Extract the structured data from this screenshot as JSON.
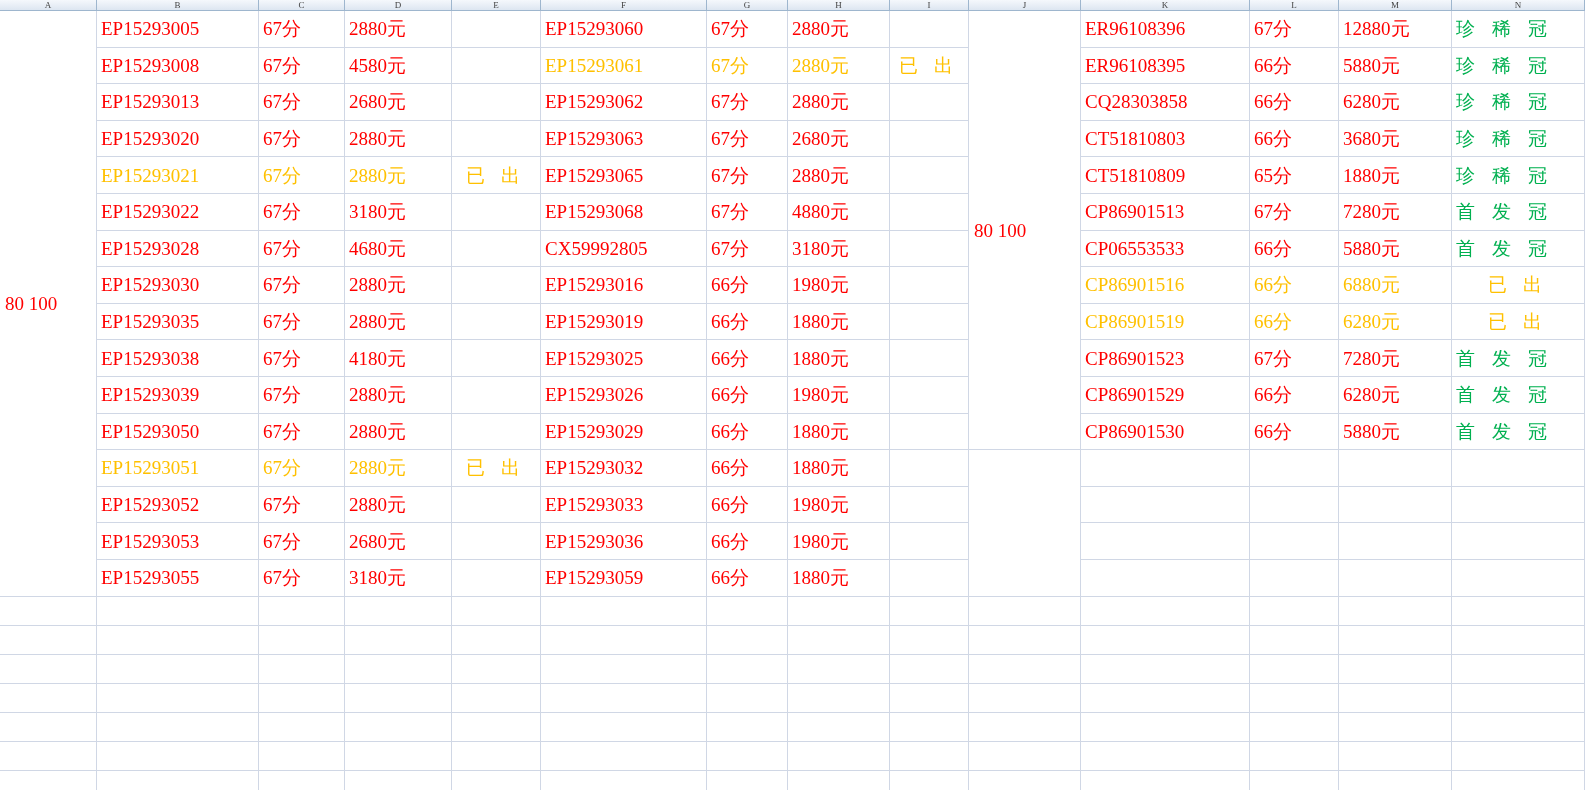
{
  "column_headers": [
    "A",
    "B",
    "C",
    "D",
    "E",
    "F",
    "G",
    "H",
    "I",
    "J",
    "K",
    "L",
    "M",
    "N"
  ],
  "left_group": {
    "label": "80 100",
    "rows": [
      [
        {
          "code": "EP15293005",
          "score": "67分",
          "price": "2880元",
          "sold": false
        },
        {
          "code": "EP15293060",
          "score": "67分",
          "price": "2880元",
          "sold": false
        }
      ],
      [
        {
          "code": "EP15293008",
          "score": "67分",
          "price": "4580元",
          "sold": false
        },
        {
          "code": "EP15293061",
          "score": "67分",
          "price": "2880元",
          "sold": true,
          "note": "已 出"
        }
      ],
      [
        {
          "code": "EP15293013",
          "score": "67分",
          "price": "2680元",
          "sold": false
        },
        {
          "code": "EP15293062",
          "score": "67分",
          "price": "2880元",
          "sold": false
        }
      ],
      [
        {
          "code": "EP15293020",
          "score": "67分",
          "price": "2880元",
          "sold": false
        },
        {
          "code": "EP15293063",
          "score": "67分",
          "price": "2680元",
          "sold": false
        }
      ],
      [
        {
          "code": "EP15293021",
          "score": "67分",
          "price": "2880元",
          "sold": true,
          "note": "已 出"
        },
        {
          "code": "EP15293065",
          "score": "67分",
          "price": "2880元",
          "sold": false
        }
      ],
      [
        {
          "code": "EP15293022",
          "score": "67分",
          "price": "3180元",
          "sold": false
        },
        {
          "code": "EP15293068",
          "score": "67分",
          "price": "4880元",
          "sold": false
        }
      ],
      [
        {
          "code": "EP15293028",
          "score": "67分",
          "price": "4680元",
          "sold": false
        },
        {
          "code": "CX59992805",
          "score": "67分",
          "price": "3180元",
          "sold": false
        }
      ],
      [
        {
          "code": "EP15293030",
          "score": "67分",
          "price": "2880元",
          "sold": false
        },
        {
          "code": "EP15293016",
          "score": "66分",
          "price": "1980元",
          "sold": false
        }
      ],
      [
        {
          "code": "EP15293035",
          "score": "67分",
          "price": "2880元",
          "sold": false
        },
        {
          "code": "EP15293019",
          "score": "66分",
          "price": "1880元",
          "sold": false
        }
      ],
      [
        {
          "code": "EP15293038",
          "score": "67分",
          "price": "4180元",
          "sold": false
        },
        {
          "code": "EP15293025",
          "score": "66分",
          "price": "1880元",
          "sold": false
        }
      ],
      [
        {
          "code": "EP15293039",
          "score": "67分",
          "price": "2880元",
          "sold": false
        },
        {
          "code": "EP15293026",
          "score": "66分",
          "price": "1980元",
          "sold": false
        }
      ],
      [
        {
          "code": "EP15293050",
          "score": "67分",
          "price": "2880元",
          "sold": false
        },
        {
          "code": "EP15293029",
          "score": "66分",
          "price": "1880元",
          "sold": false
        }
      ],
      [
        {
          "code": "EP15293051",
          "score": "67分",
          "price": "2880元",
          "sold": true,
          "note": "已 出"
        },
        {
          "code": "EP15293032",
          "score": "66分",
          "price": "1880元",
          "sold": false
        }
      ],
      [
        {
          "code": "EP15293052",
          "score": "67分",
          "price": "2880元",
          "sold": false
        },
        {
          "code": "EP15293033",
          "score": "66分",
          "price": "1980元",
          "sold": false
        }
      ],
      [
        {
          "code": "EP15293053",
          "score": "67分",
          "price": "2680元",
          "sold": false
        },
        {
          "code": "EP15293036",
          "score": "66分",
          "price": "1980元",
          "sold": false
        }
      ],
      [
        {
          "code": "EP15293055",
          "score": "67分",
          "price": "3180元",
          "sold": false
        },
        {
          "code": "EP15293059",
          "score": "66分",
          "price": "1880元",
          "sold": false
        }
      ]
    ]
  },
  "right_group": {
    "label": "80 100",
    "rows": [
      {
        "code": "ER96108396",
        "score": "67分",
        "price": "12880元",
        "sold": false,
        "note": "珍 稀 冠"
      },
      {
        "code": "ER96108395",
        "score": "66分",
        "price": "5880元",
        "sold": false,
        "note": "珍 稀 冠"
      },
      {
        "code": "CQ28303858",
        "score": "66分",
        "price": "6280元",
        "sold": false,
        "note": "珍 稀 冠"
      },
      {
        "code": "CT51810803",
        "score": "66分",
        "price": "3680元",
        "sold": false,
        "note": "珍 稀 冠"
      },
      {
        "code": "CT51810809",
        "score": "65分",
        "price": "1880元",
        "sold": false,
        "note": "珍 稀 冠"
      },
      {
        "code": "CP86901513",
        "score": "67分",
        "price": "7280元",
        "sold": false,
        "note": "首 发 冠"
      },
      {
        "code": "CP06553533",
        "score": "66分",
        "price": "5880元",
        "sold": false,
        "note": "首 发 冠"
      },
      {
        "code": "CP86901516",
        "score": "66分",
        "price": "6880元",
        "sold": true,
        "note": "已 出"
      },
      {
        "code": "CP86901519",
        "score": "66分",
        "price": "6280元",
        "sold": true,
        "note": "已 出"
      },
      {
        "code": "CP86901523",
        "score": "67分",
        "price": "7280元",
        "sold": false,
        "note": "首 发 冠"
      },
      {
        "code": "CP86901529",
        "score": "66分",
        "price": "6280元",
        "sold": false,
        "note": "首 发 冠"
      },
      {
        "code": "CP86901530",
        "score": "66分",
        "price": "5880元",
        "sold": false,
        "note": "首 发 冠"
      }
    ]
  }
}
